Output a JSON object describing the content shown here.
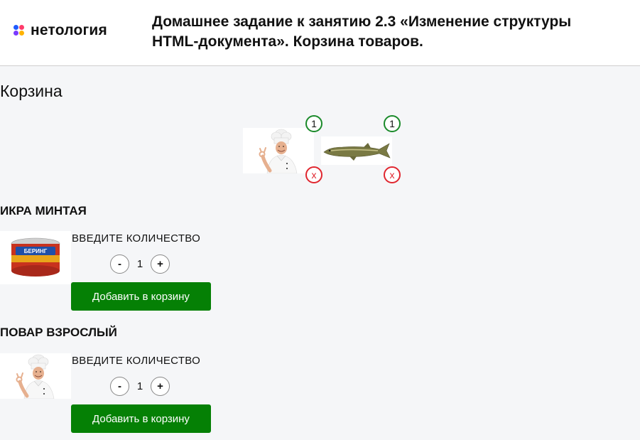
{
  "header": {
    "logo_text": "нетология",
    "title": "Домашнее задание к занятию 2.3 «Изменение структуры HTML-документа». Корзина товаров."
  },
  "cart": {
    "title": "Корзина",
    "items": [
      {
        "image": "chef-image",
        "count": "1",
        "remove_label": "x"
      },
      {
        "image": "pike-fish-image",
        "count": "1",
        "remove_label": "x"
      }
    ]
  },
  "products": [
    {
      "title": "ИКРА МИНТАЯ",
      "image": "canned-caviar-image",
      "quantity_label": "ВВЕДИТЕ КОЛИЧЕСТВО",
      "decrement_label": "-",
      "quantity": "1",
      "increment_label": "+",
      "add_button_label": "Добавить в корзину",
      "can_label": "БЕРИНГ"
    },
    {
      "title": "ПОВАР ВЗРОСЛЫЙ",
      "image": "chef-image",
      "quantity_label": "ВВЕДИТЕ КОЛИЧЕСТВО",
      "decrement_label": "-",
      "quantity": "1",
      "increment_label": "+",
      "add_button_label": "Добавить в корзину"
    }
  ],
  "colors": {
    "button_green": "#058005",
    "badge_green": "#1a8a2a",
    "badge_red": "#e0262f",
    "logo_dots": [
      "#1f5bff",
      "#ff3b6a",
      "#7b3bff",
      "#ffb300"
    ]
  }
}
